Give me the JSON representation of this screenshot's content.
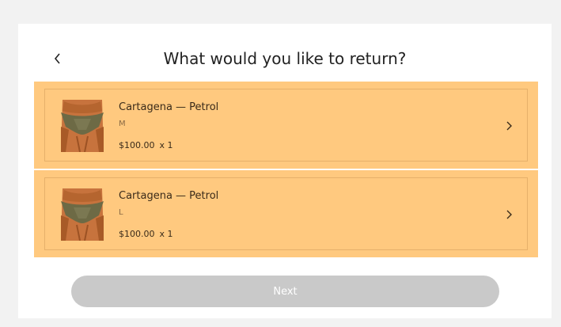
{
  "header": {
    "title": "What would you like to return?",
    "back_icon": "chevron-left-icon"
  },
  "items": [
    {
      "name": "Cartagena — Petrol",
      "size": "M",
      "price": "$100.00",
      "qty": "x 1",
      "chevron_icon": "chevron-right-icon"
    },
    {
      "name": "Cartagena — Petrol",
      "size": "L",
      "price": "$100.00",
      "qty": "x 1",
      "chevron_icon": "chevron-right-icon"
    }
  ],
  "footer": {
    "next_label": "Next",
    "next_enabled": false
  },
  "colors": {
    "item_highlight": "#ffc97f",
    "button_disabled": "#c9c9c9",
    "card_bg": "#ffffff"
  }
}
